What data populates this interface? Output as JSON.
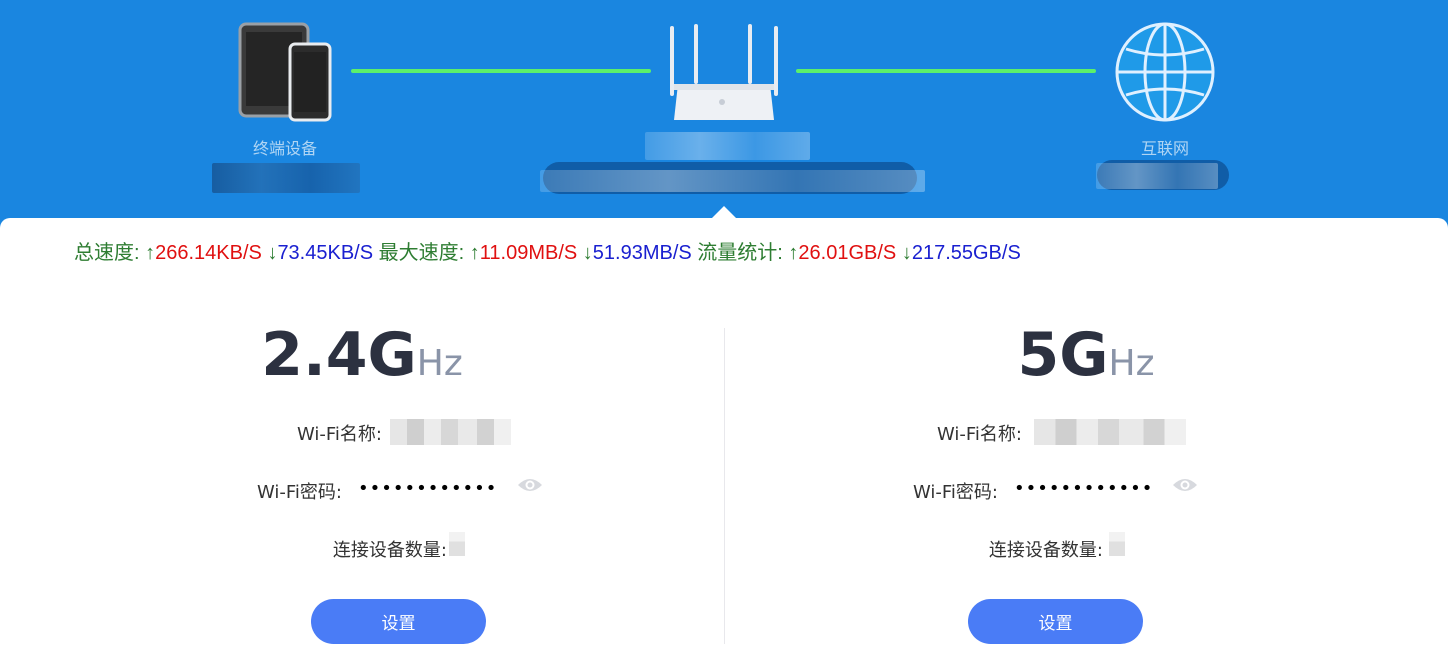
{
  "topology": {
    "terminal_label": "终端设备",
    "internet_label": "互联网"
  },
  "stats": {
    "total_label": "总速度:",
    "total_up": "266.14KB/S",
    "total_down": "73.45KB/S",
    "max_label": "最大速度:",
    "max_up": "11.09MB/S",
    "max_down": "51.93MB/S",
    "traffic_label": "流量统计:",
    "traffic_up": "26.01GB/S",
    "traffic_down": "217.55GB/S",
    "up_arrow": "↑",
    "down_arrow": "↓"
  },
  "bands": [
    {
      "freq": "2.4G",
      "unit": "Hz",
      "wifi_name_label": "Wi-Fi名称:",
      "wifi_pwd_label": "Wi-Fi密码:",
      "wifi_pwd_value": "••••••••••••",
      "devices_label": "连接设备数量:",
      "setting_label": "设置"
    },
    {
      "freq": "5G",
      "unit": "Hz",
      "wifi_name_label": "Wi-Fi名称:",
      "wifi_pwd_label": "Wi-Fi密码:",
      "wifi_pwd_value": "••••••••••••",
      "devices_label": "连接设备数量:",
      "setting_label": "设置"
    }
  ],
  "colors": {
    "banner": "#1a86e0",
    "link": "#5cf06a",
    "button": "#4a7cf6",
    "up_value": "#e01010",
    "down_value": "#1a20d0",
    "label_green": "#2e7d32"
  }
}
